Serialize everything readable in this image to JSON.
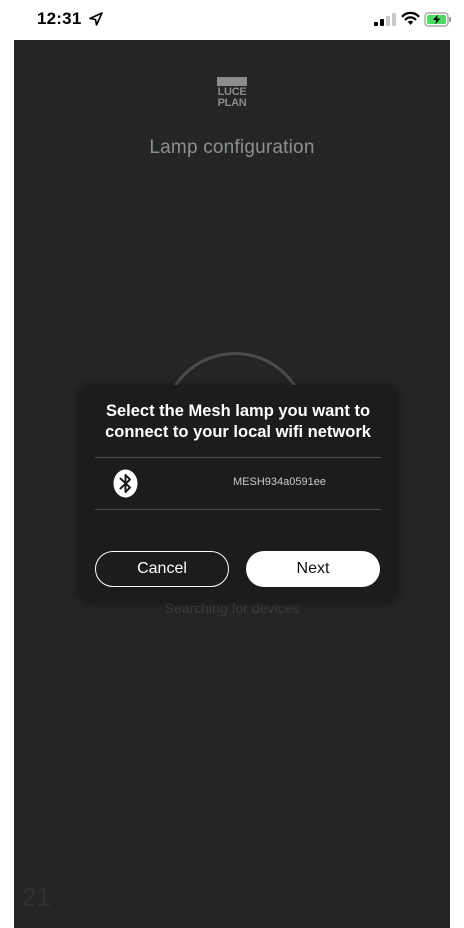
{
  "status_bar": {
    "time": "12:31",
    "location_icon": "location-arrow-icon",
    "signal_icon": "cellular-signal-icon",
    "wifi_icon": "wifi-icon",
    "battery_icon": "battery-charging-icon"
  },
  "header": {
    "logo_line1": "LUCE",
    "logo_line2": "PLAN",
    "title": "Lamp configuration"
  },
  "background": {
    "searching_text": "Searching for devices",
    "page_number": "21"
  },
  "dialog": {
    "title_line1": "Select the Mesh lamp you want to",
    "title_line2": "connect to your local wifi network",
    "devices": [
      {
        "icon": "bluetooth-icon",
        "name": "MESH934a0591ee"
      }
    ],
    "cancel_label": "Cancel",
    "next_label": "Next"
  },
  "colors": {
    "screen_bg": "#232526",
    "dialog_bg": "#1b1c1d",
    "text_primary": "#ffffff",
    "text_muted": "#8e9090"
  }
}
